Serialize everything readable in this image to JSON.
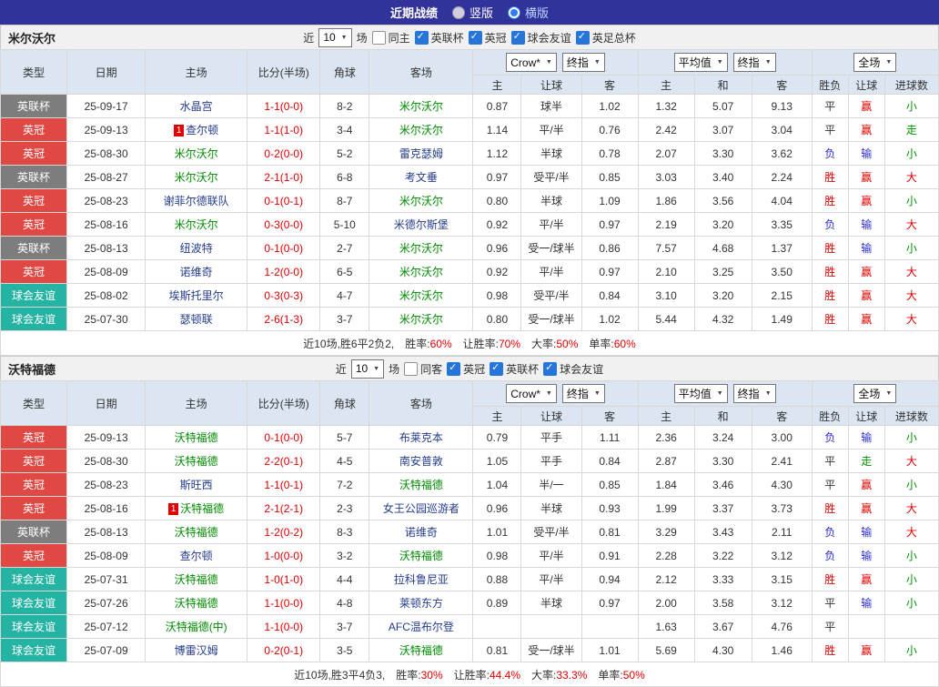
{
  "topbar": {
    "title": "近期战绩",
    "layout_options": [
      {
        "label": "竖版",
        "checked": false
      },
      {
        "label": "横版",
        "checked": true
      }
    ]
  },
  "result_color_map": {
    "胜": "red",
    "负": "blue",
    "平": "black",
    "赢": "red",
    "输": "blue",
    "走": "green",
    "大": "red",
    "小": "green"
  },
  "type_colors": {
    "英联杯": "gray",
    "英冠": "red",
    "球会友谊": "teal",
    "英足总杯": "gray"
  },
  "table_header": {
    "type": "类型",
    "date": "日期",
    "home": "主场",
    "score": "比分(半场)",
    "corner": "角球",
    "away": "客场",
    "odds_selects": [
      "Crow*",
      "终指"
    ],
    "avg_selects": [
      "平均值",
      "终指"
    ],
    "full_select": "全场",
    "sub_odds": [
      "主",
      "让球",
      "客"
    ],
    "sub_avg": [
      "主",
      "和",
      "客"
    ],
    "sub_result": [
      "胜负",
      "让球",
      "进球数"
    ]
  },
  "sections": [
    {
      "team": "米尔沃尔",
      "filters": {
        "near": "近",
        "count": "10",
        "games": "场",
        "same": "同主",
        "same_checked": false,
        "leagues": [
          "英联杯",
          "英冠",
          "球会友谊",
          "英足总杯"
        ]
      },
      "rows": [
        {
          "type": "英联杯",
          "date": "25-09-17",
          "home": "水晶宫",
          "home_focus": false,
          "home_card": "",
          "score": "1-1(0-0)",
          "corner": "8-2",
          "away": "米尔沃尔",
          "away_focus": true,
          "away_card": "",
          "odds": [
            "0.87",
            "球半",
            "1.02"
          ],
          "avg": [
            "1.32",
            "5.07",
            "9.13"
          ],
          "results": [
            "平",
            "赢",
            "小"
          ]
        },
        {
          "type": "英冠",
          "date": "25-09-13",
          "home": "查尔顿",
          "home_focus": false,
          "home_card": "1",
          "score": "1-1(1-0)",
          "corner": "3-4",
          "away": "米尔沃尔",
          "away_focus": true,
          "away_card": "",
          "odds": [
            "1.14",
            "平/半",
            "0.76"
          ],
          "avg": [
            "2.42",
            "3.07",
            "3.04"
          ],
          "results": [
            "平",
            "赢",
            "走"
          ]
        },
        {
          "type": "英冠",
          "date": "25-08-30",
          "home": "米尔沃尔",
          "home_focus": true,
          "home_card": "",
          "score": "0-2(0-0)",
          "corner": "5-2",
          "away": "雷克瑟姆",
          "away_focus": false,
          "away_card": "",
          "odds": [
            "1.12",
            "半球",
            "0.78"
          ],
          "avg": [
            "2.07",
            "3.30",
            "3.62"
          ],
          "results": [
            "负",
            "输",
            "小"
          ]
        },
        {
          "type": "英联杯",
          "date": "25-08-27",
          "home": "米尔沃尔",
          "home_focus": true,
          "home_card": "",
          "score": "2-1(1-0)",
          "corner": "6-8",
          "away": "考文垂",
          "away_focus": false,
          "away_card": "",
          "odds": [
            "0.97",
            "受平/半",
            "0.85"
          ],
          "avg": [
            "3.03",
            "3.40",
            "2.24"
          ],
          "results": [
            "胜",
            "赢",
            "大"
          ]
        },
        {
          "type": "英冠",
          "date": "25-08-23",
          "home": "谢菲尔德联队",
          "home_focus": false,
          "home_card": "",
          "score": "0-1(0-1)",
          "corner": "8-7",
          "away": "米尔沃尔",
          "away_focus": true,
          "away_card": "",
          "odds": [
            "0.80",
            "半球",
            "1.09"
          ],
          "avg": [
            "1.86",
            "3.56",
            "4.04"
          ],
          "results": [
            "胜",
            "赢",
            "小"
          ]
        },
        {
          "type": "英冠",
          "date": "25-08-16",
          "home": "米尔沃尔",
          "home_focus": true,
          "home_card": "",
          "score": "0-3(0-0)",
          "corner": "5-10",
          "away": "米德尔斯堡",
          "away_focus": false,
          "away_card": "",
          "odds": [
            "0.92",
            "平/半",
            "0.97"
          ],
          "avg": [
            "2.19",
            "3.20",
            "3.35"
          ],
          "results": [
            "负",
            "输",
            "大"
          ]
        },
        {
          "type": "英联杯",
          "date": "25-08-13",
          "home": "纽波特",
          "home_focus": false,
          "home_card": "",
          "score": "0-1(0-0)",
          "corner": "2-7",
          "away": "米尔沃尔",
          "away_focus": true,
          "away_card": "",
          "odds": [
            "0.96",
            "受一/球半",
            "0.86"
          ],
          "avg": [
            "7.57",
            "4.68",
            "1.37"
          ],
          "results": [
            "胜",
            "输",
            "小"
          ]
        },
        {
          "type": "英冠",
          "date": "25-08-09",
          "home": "诺维奇",
          "home_focus": false,
          "home_card": "",
          "score": "1-2(0-0)",
          "corner": "6-5",
          "away": "米尔沃尔",
          "away_focus": true,
          "away_card": "",
          "odds": [
            "0.92",
            "平/半",
            "0.97"
          ],
          "avg": [
            "2.10",
            "3.25",
            "3.50"
          ],
          "results": [
            "胜",
            "赢",
            "大"
          ]
        },
        {
          "type": "球会友谊",
          "date": "25-08-02",
          "home": "埃斯托里尔",
          "home_focus": false,
          "home_card": "",
          "score": "0-3(0-3)",
          "corner": "4-7",
          "away": "米尔沃尔",
          "away_focus": true,
          "away_card": "",
          "odds": [
            "0.98",
            "受平/半",
            "0.84"
          ],
          "avg": [
            "3.10",
            "3.20",
            "2.15"
          ],
          "results": [
            "胜",
            "赢",
            "大"
          ]
        },
        {
          "type": "球会友谊",
          "date": "25-07-30",
          "home": "瑟顿联",
          "home_focus": false,
          "home_card": "",
          "score": "2-6(1-3)",
          "corner": "3-7",
          "away": "米尔沃尔",
          "away_focus": true,
          "away_card": "",
          "odds": [
            "0.80",
            "受一/球半",
            "1.02"
          ],
          "avg": [
            "5.44",
            "4.32",
            "1.49"
          ],
          "results": [
            "胜",
            "赢",
            "大"
          ]
        }
      ],
      "summary": {
        "prefix": "近10场,胜6平2负2,",
        "stats": [
          {
            "label": "胜率:",
            "value": "60%"
          },
          {
            "label": "让胜率:",
            "value": "70%"
          },
          {
            "label": "大率:",
            "value": "50%"
          },
          {
            "label": "单率:",
            "value": "60%"
          }
        ]
      }
    },
    {
      "team": "沃特福德",
      "filters": {
        "near": "近",
        "count": "10",
        "games": "场",
        "same": "同客",
        "same_checked": false,
        "leagues": [
          "英冠",
          "英联杯",
          "球会友谊"
        ]
      },
      "rows": [
        {
          "type": "英冠",
          "date": "25-09-13",
          "home": "沃特福德",
          "home_focus": true,
          "home_card": "",
          "score": "0-1(0-0)",
          "corner": "5-7",
          "away": "布莱克本",
          "away_focus": false,
          "away_card": "",
          "odds": [
            "0.79",
            "平手",
            "1.11"
          ],
          "avg": [
            "2.36",
            "3.24",
            "3.00"
          ],
          "results": [
            "负",
            "输",
            "小"
          ]
        },
        {
          "type": "英冠",
          "date": "25-08-30",
          "home": "沃特福德",
          "home_focus": true,
          "home_card": "",
          "score": "2-2(0-1)",
          "corner": "4-5",
          "away": "南安普敦",
          "away_focus": false,
          "away_card": "",
          "odds": [
            "1.05",
            "平手",
            "0.84"
          ],
          "avg": [
            "2.87",
            "3.30",
            "2.41"
          ],
          "results": [
            "平",
            "走",
            "大"
          ]
        },
        {
          "type": "英冠",
          "date": "25-08-23",
          "home": "斯旺西",
          "home_focus": false,
          "home_card": "",
          "score": "1-1(0-1)",
          "corner": "7-2",
          "away": "沃特福德",
          "away_focus": true,
          "away_card": "",
          "odds": [
            "1.04",
            "半/一",
            "0.85"
          ],
          "avg": [
            "1.84",
            "3.46",
            "4.30"
          ],
          "results": [
            "平",
            "赢",
            "小"
          ]
        },
        {
          "type": "英冠",
          "date": "25-08-16",
          "home": "沃特福德",
          "home_focus": true,
          "home_card": "1",
          "score": "2-1(2-1)",
          "corner": "2-3",
          "away": "女王公园巡游者",
          "away_focus": false,
          "away_card": "",
          "odds": [
            "0.96",
            "半球",
            "0.93"
          ],
          "avg": [
            "1.99",
            "3.37",
            "3.73"
          ],
          "results": [
            "胜",
            "赢",
            "大"
          ]
        },
        {
          "type": "英联杯",
          "date": "25-08-13",
          "home": "沃特福德",
          "home_focus": true,
          "home_card": "",
          "score": "1-2(0-2)",
          "corner": "8-3",
          "away": "诺维奇",
          "away_focus": false,
          "away_card": "",
          "odds": [
            "1.01",
            "受平/半",
            "0.81"
          ],
          "avg": [
            "3.29",
            "3.43",
            "2.11"
          ],
          "results": [
            "负",
            "输",
            "大"
          ]
        },
        {
          "type": "英冠",
          "date": "25-08-09",
          "home": "查尔顿",
          "home_focus": false,
          "home_card": "",
          "score": "1-0(0-0)",
          "corner": "3-2",
          "away": "沃特福德",
          "away_focus": true,
          "away_card": "",
          "odds": [
            "0.98",
            "平/半",
            "0.91"
          ],
          "avg": [
            "2.28",
            "3.22",
            "3.12"
          ],
          "results": [
            "负",
            "输",
            "小"
          ]
        },
        {
          "type": "球会友谊",
          "date": "25-07-31",
          "home": "沃特福德",
          "home_focus": true,
          "home_card": "",
          "score": "1-0(1-0)",
          "corner": "4-4",
          "away": "拉科鲁尼亚",
          "away_focus": false,
          "away_card": "",
          "odds": [
            "0.88",
            "平/半",
            "0.94"
          ],
          "avg": [
            "2.12",
            "3.33",
            "3.15"
          ],
          "results": [
            "胜",
            "赢",
            "小"
          ]
        },
        {
          "type": "球会友谊",
          "date": "25-07-26",
          "home": "沃特福德",
          "home_focus": true,
          "home_card": "",
          "score": "1-1(0-0)",
          "corner": "4-8",
          "away": "莱顿东方",
          "away_focus": false,
          "away_card": "",
          "odds": [
            "0.89",
            "半球",
            "0.97"
          ],
          "avg": [
            "2.00",
            "3.58",
            "3.12"
          ],
          "results": [
            "平",
            "输",
            "小"
          ]
        },
        {
          "type": "球会友谊",
          "date": "25-07-12",
          "home": "沃特福德(中)",
          "home_focus": true,
          "home_card": "",
          "score": "1-1(0-0)",
          "corner": "3-7",
          "away": "AFC温布尔登",
          "away_focus": false,
          "away_card": "",
          "odds": [
            "",
            "",
            ""
          ],
          "avg": [
            "1.63",
            "3.67",
            "4.76"
          ],
          "results": [
            "平",
            "",
            ""
          ]
        },
        {
          "type": "球会友谊",
          "date": "25-07-09",
          "home": "博雷汉姆",
          "home_focus": false,
          "home_card": "",
          "score": "0-2(0-1)",
          "corner": "3-5",
          "away": "沃特福德",
          "away_focus": true,
          "away_card": "",
          "odds": [
            "0.81",
            "受一/球半",
            "1.01"
          ],
          "avg": [
            "5.69",
            "4.30",
            "1.46"
          ],
          "results": [
            "胜",
            "赢",
            "小"
          ]
        }
      ],
      "summary": {
        "prefix": "近10场,胜3平4负3,",
        "stats": [
          {
            "label": "胜率:",
            "value": "30%"
          },
          {
            "label": "让胜率:",
            "value": "44.4%"
          },
          {
            "label": "大率:",
            "value": "33.3%"
          },
          {
            "label": "单率:",
            "value": "50%"
          }
        ]
      }
    }
  ]
}
